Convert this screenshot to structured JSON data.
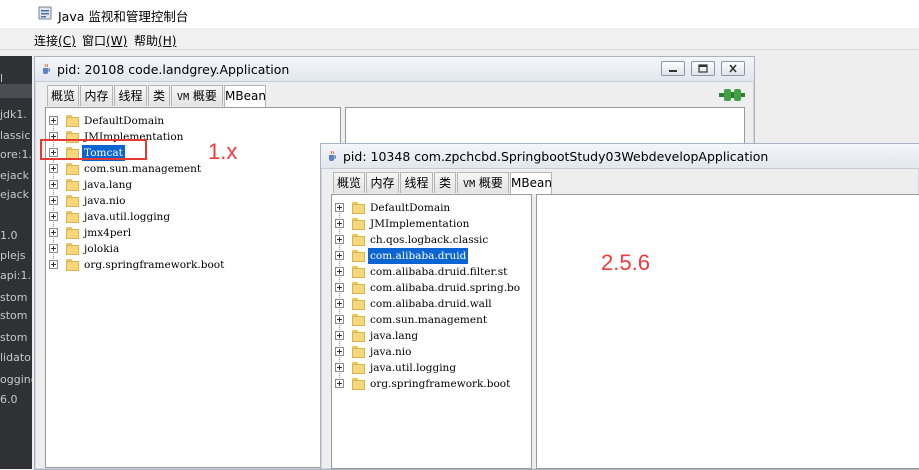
{
  "app": {
    "title": "Java 监视和管理控制台"
  },
  "menubar": [
    {
      "label": "连接",
      "mnemonic": "(C)"
    },
    {
      "label": "窗口",
      "mnemonic": "(W)"
    },
    {
      "label": "帮助",
      "mnemonic": "(H)"
    }
  ],
  "ide_strip": [
    "l",
    "jdk1.",
    "lassic",
    "ore:1.",
    "ejack",
    "ejack",
    "1.0",
    "plejs",
    "api:1.",
    "stom",
    "stom",
    "stom",
    "lidato",
    "ogging",
    "6.0"
  ],
  "tabs": [
    {
      "label": "概览"
    },
    {
      "label": "内存"
    },
    {
      "label": "线程"
    },
    {
      "label": "类"
    },
    {
      "label_mono": "VM",
      "label": "概要"
    },
    {
      "label": "MBean"
    }
  ],
  "frame1": {
    "title": "pid: 20108 code.landgrey.Application",
    "tree": [
      "DefaultDomain",
      "JMImplementation",
      "Tomcat",
      "com.sun.management",
      "java.lang",
      "java.nio",
      "java.util.logging",
      "jmx4perl",
      "jolokia",
      "org.springframework.boot"
    ],
    "selected_index": 2,
    "annotation": "1.x"
  },
  "frame2": {
    "title": "pid: 10348 com.zpchcbd.SpringbootStudy03WebdevelopApplication",
    "tree": [
      "DefaultDomain",
      "JMImplementation",
      "ch.qos.logback.classic",
      "com.alibaba.druid",
      "com.alibaba.druid.filter.st",
      "com.alibaba.druid.spring.bo",
      "com.alibaba.druid.wall",
      "com.sun.management",
      "java.lang",
      "java.nio",
      "java.util.logging",
      "org.springframework.boot"
    ],
    "selected_index": 3,
    "annotation": "2.5.6"
  },
  "colors": {
    "selection": "#0a64d2",
    "annotation": "#ef3b3b",
    "highlight_box": "#e53935"
  },
  "icons": {
    "window_buttons": [
      "minimize-icon",
      "restore-icon",
      "close-icon"
    ],
    "connection": "connection-plug-icon"
  }
}
